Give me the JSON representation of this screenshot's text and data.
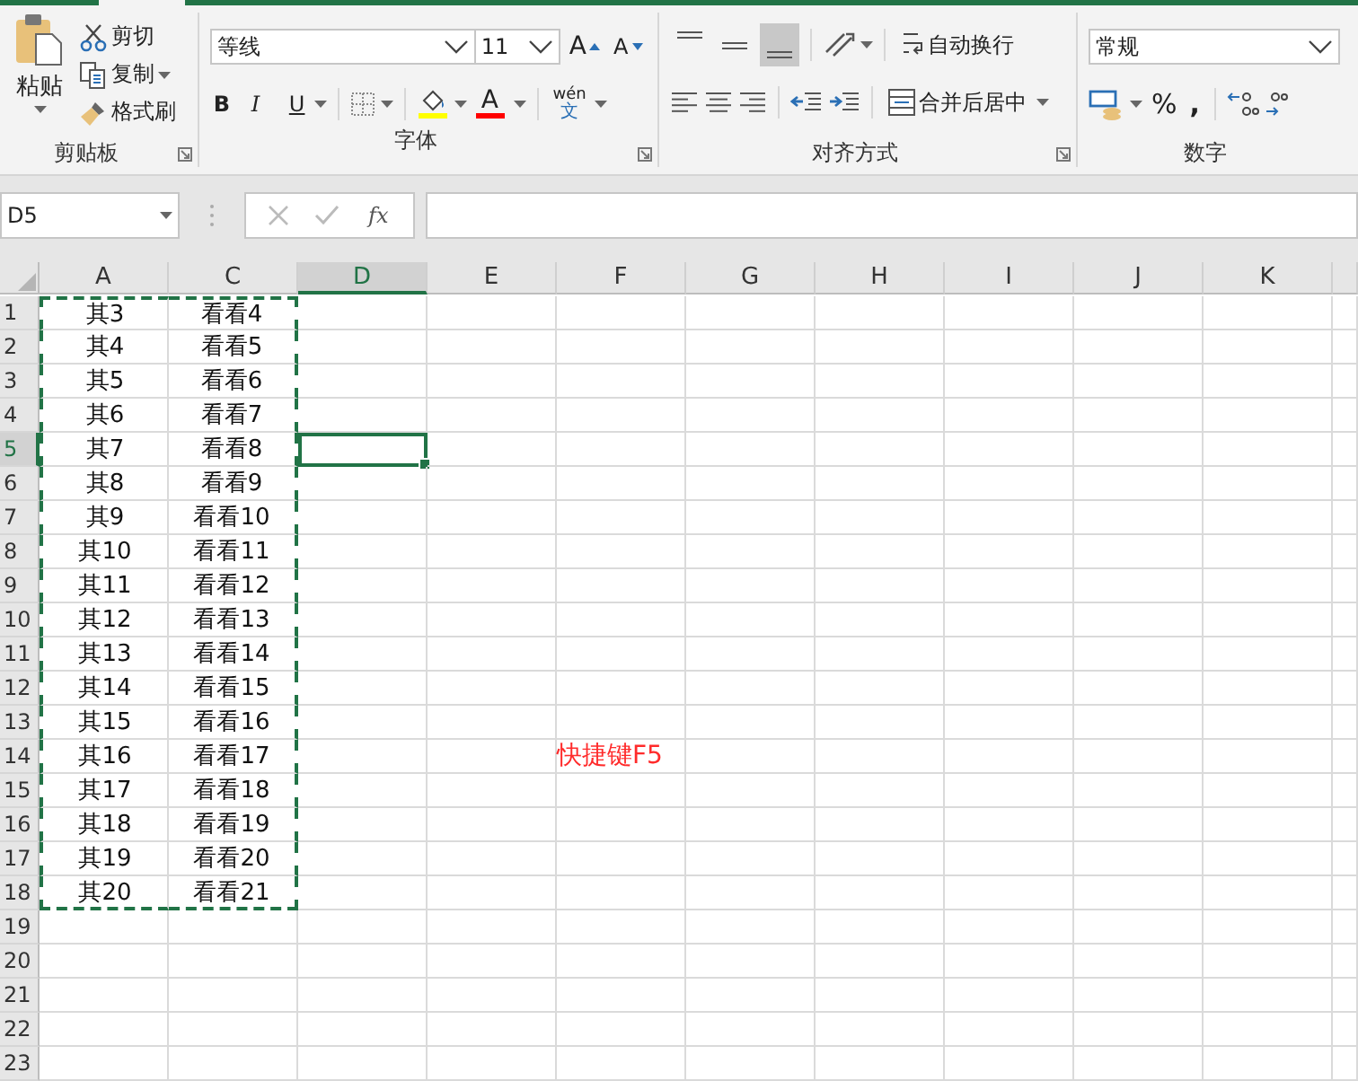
{
  "ribbon": {
    "clipboard": {
      "paste": "粘贴",
      "cut": "剪切",
      "copy": "复制",
      "format_painter": "格式刷",
      "label": "剪贴板"
    },
    "font": {
      "font_name": "等线",
      "font_size": "11",
      "grow": "A",
      "shrink": "A",
      "bold": "B",
      "italic": "I",
      "underline": "U",
      "font_color": "A",
      "phonetic_top": "wén",
      "phonetic_bottom": "文",
      "label": "字体"
    },
    "alignment": {
      "vertical": [
        {
          "selected": false
        },
        {
          "selected": false
        },
        {
          "selected": true
        }
      ],
      "wrap_text": "自动换行",
      "merge_center": "合并后居中",
      "label": "对齐方式"
    },
    "number": {
      "format": "常规",
      "percent": "%",
      "comma": ",",
      "label": "数字"
    }
  },
  "formula_bar": {
    "name_box": "D5",
    "fx": "fx"
  },
  "sheet": {
    "columns": [
      {
        "label": "A",
        "selected": false
      },
      {
        "label": "C",
        "selected": false
      },
      {
        "label": "D",
        "selected": true
      },
      {
        "label": "E",
        "selected": false
      },
      {
        "label": "F",
        "selected": false
      },
      {
        "label": "G",
        "selected": false
      },
      {
        "label": "H",
        "selected": false
      },
      {
        "label": "I",
        "selected": false
      },
      {
        "label": "J",
        "selected": false
      },
      {
        "label": "K",
        "selected": false
      }
    ],
    "rows": [
      {
        "label": "1",
        "selected": false,
        "copied": true,
        "cells": [
          "其3",
          "看看4"
        ]
      },
      {
        "label": "2",
        "selected": false,
        "copied": true,
        "cells": [
          "其4",
          "看看5"
        ]
      },
      {
        "label": "3",
        "selected": false,
        "copied": true,
        "cells": [
          "其5",
          "看看6"
        ]
      },
      {
        "label": "4",
        "selected": false,
        "copied": true,
        "cells": [
          "其6",
          "看看7"
        ]
      },
      {
        "label": "5",
        "selected": true,
        "copied": true,
        "cells": [
          "其7",
          "看看8"
        ]
      },
      {
        "label": "6",
        "selected": false,
        "copied": true,
        "cells": [
          "其8",
          "看看9"
        ]
      },
      {
        "label": "7",
        "selected": false,
        "copied": true,
        "cells": [
          "其9",
          "看看10"
        ]
      },
      {
        "label": "8",
        "selected": false,
        "copied": true,
        "cells": [
          "其10",
          "看看11"
        ]
      },
      {
        "label": "9",
        "selected": false,
        "copied": true,
        "cells": [
          "其11",
          "看看12"
        ]
      },
      {
        "label": "10",
        "selected": false,
        "copied": true,
        "cells": [
          "其12",
          "看看13"
        ]
      },
      {
        "label": "11",
        "selected": false,
        "copied": true,
        "cells": [
          "其13",
          "看看14"
        ]
      },
      {
        "label": "12",
        "selected": false,
        "copied": true,
        "cells": [
          "其14",
          "看看15"
        ]
      },
      {
        "label": "13",
        "selected": false,
        "copied": true,
        "cells": [
          "其15",
          "看看16"
        ]
      },
      {
        "label": "14",
        "selected": false,
        "copied": true,
        "cells": [
          "其16",
          "看看17"
        ],
        "note": "快捷键F5"
      },
      {
        "label": "15",
        "selected": false,
        "copied": true,
        "cells": [
          "其17",
          "看看18"
        ]
      },
      {
        "label": "16",
        "selected": false,
        "copied": true,
        "cells": [
          "其18",
          "看看19"
        ]
      },
      {
        "label": "17",
        "selected": false,
        "copied": true,
        "cells": [
          "其19",
          "看看20"
        ]
      },
      {
        "label": "18",
        "selected": false,
        "copied": true,
        "cells": [
          "其20",
          "看看21"
        ]
      },
      {
        "label": "19",
        "selected": false,
        "copied": false,
        "cells": []
      },
      {
        "label": "20",
        "selected": false,
        "copied": false,
        "cells": []
      },
      {
        "label": "21",
        "selected": false,
        "copied": false,
        "cells": []
      },
      {
        "label": "22",
        "selected": false,
        "copied": false,
        "cells": []
      },
      {
        "label": "23",
        "selected": false,
        "copied": false,
        "cells": []
      }
    ]
  }
}
